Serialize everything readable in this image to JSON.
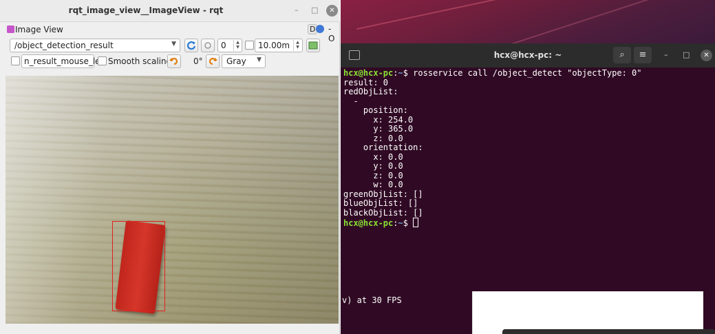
{
  "rqt": {
    "window_title": "rqt_image_view__ImageView - rqt",
    "dock_title": "Image View",
    "dock_badge": "D",
    "dock_extra": "- O",
    "topic": "/object_detection_result",
    "spin_value": "0",
    "max_depth": "10.00m",
    "mouse_topic": "n_result_mouse_left",
    "smooth_scaling_label": "Smooth scaling",
    "rotation": "0°",
    "colormap": "Gray"
  },
  "terminal": {
    "title": "hcx@hcx-pc: ~",
    "prompt_user": "hcx@hcx-pc",
    "prompt_sep": ":",
    "prompt_path": "~",
    "prompt_dollar": "$",
    "command": " rosservice call /object_detect \"objectType: 0\"",
    "output": [
      "result: 0",
      "redObjList:",
      "  -",
      "    position:",
      "      x: 254.0",
      "      y: 365.0",
      "      z: 0.0",
      "    orientation:",
      "      x: 0.0",
      "      y: 0.0",
      "      z: 0.0",
      "      w: 0.0",
      "greenObjList: []",
      "blueObjList: []",
      "blackObjList: []"
    ]
  },
  "background_terminal": {
    "text": "v) at 30 FPS"
  },
  "colors": {
    "terminal_bg": "#300a24",
    "prompt_user": "#8ae234",
    "prompt_path": "#729fcf",
    "detection_box": "#e02020"
  }
}
